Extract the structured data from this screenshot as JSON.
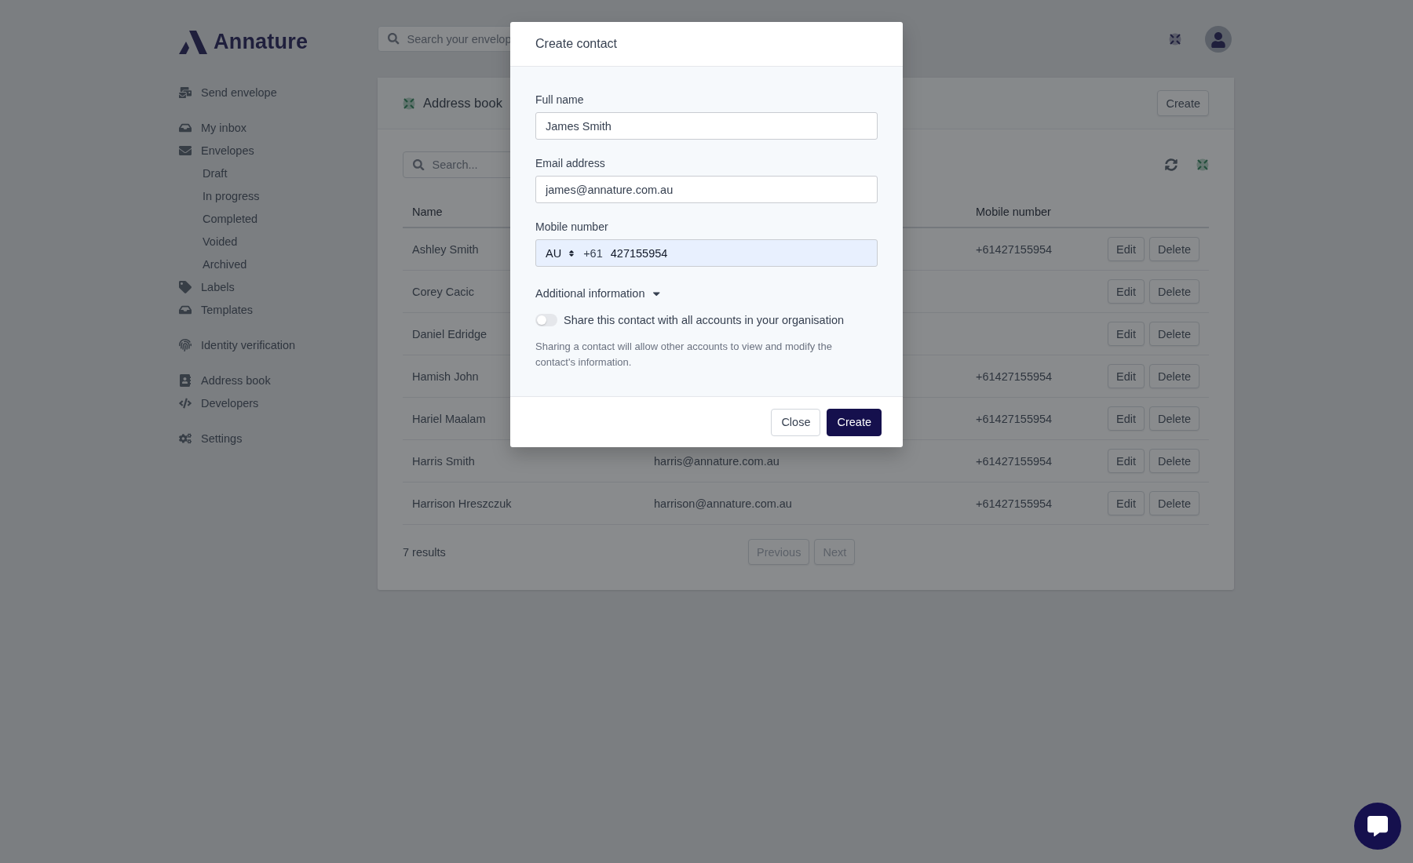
{
  "brand": {
    "name": "Annature"
  },
  "top_search": {
    "placeholder": "Search your envelop"
  },
  "sidebar": {
    "groups": [
      [
        {
          "label": "Send envelope"
        }
      ],
      [
        {
          "label": "My inbox"
        },
        {
          "label": "Envelopes",
          "children": [
            {
              "label": "Draft"
            },
            {
              "label": "In progress"
            },
            {
              "label": "Completed"
            },
            {
              "label": "Voided"
            },
            {
              "label": "Archived"
            }
          ]
        },
        {
          "label": "Labels"
        },
        {
          "label": "Templates"
        }
      ],
      [
        {
          "label": "Identity verification"
        }
      ],
      [
        {
          "label": "Address book"
        },
        {
          "label": "Developers"
        }
      ],
      [
        {
          "label": "Settings"
        }
      ]
    ]
  },
  "page": {
    "title": "Address book",
    "create_button": "Create",
    "search": {
      "placeholder": "Search..."
    }
  },
  "table": {
    "columns": {
      "name": "Name",
      "mobile": "Mobile number"
    },
    "rows": [
      {
        "name": "Ashley Smith",
        "mobile": "+61427155954",
        "actions": [
          "Edit",
          "Delete"
        ]
      },
      {
        "name": "Corey Cacic",
        "actions": [
          "Edit",
          "Delete"
        ]
      },
      {
        "name": "Daniel Edridge",
        "actions": [
          "Edit",
          "Delete"
        ]
      },
      {
        "name": "Hamish John",
        "mobile": "+61427155954",
        "actions": [
          "Edit",
          "Delete"
        ]
      },
      {
        "name": "Hariel Maalam",
        "mobile": "+61427155954",
        "actions": [
          "Edit",
          "Delete"
        ]
      },
      {
        "name": "Harris Smith",
        "email": "harris@annature.com.au",
        "mobile": "+61427155954",
        "actions": [
          "Edit",
          "Delete"
        ]
      },
      {
        "name": "Harrison Hreszczuk",
        "email": "harrison@annature.com.au",
        "mobile": "+61427155954",
        "actions": [
          "Edit",
          "Delete"
        ]
      }
    ]
  },
  "pagination": {
    "count": "7 results",
    "buttons": [
      {
        "label": "Previous",
        "disabled": true
      },
      {
        "label": "Next",
        "disabled": true
      }
    ]
  },
  "modal": {
    "title": "Create contact",
    "fields": [
      {
        "label": "Full name",
        "value": "James Smith"
      },
      {
        "label": "Email address",
        "value": "james@annature.com.au"
      }
    ],
    "mobile": {
      "label": "Mobile number",
      "country": "AU",
      "prefix": "+61",
      "value": "427155954"
    },
    "additional": {
      "label": "Additional information",
      "expanded": true
    },
    "share": {
      "label": "Share this contact with all accounts in your organisation",
      "on": false
    },
    "help": "Sharing a contact will allow other accounts to view and modify the contact's information.",
    "buttons": [
      {
        "label": "Close",
        "kind": "secondary"
      },
      {
        "label": "Create",
        "kind": "primary"
      }
    ]
  }
}
